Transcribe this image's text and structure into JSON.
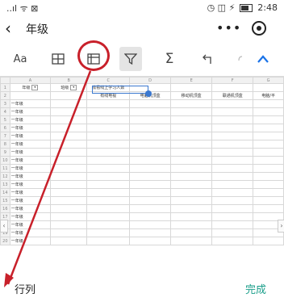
{
  "status_bar": {
    "signal": "..ıl ᯤ ⊠",
    "time": "2:48",
    "indicators": "◷ ◫ ⚡"
  },
  "title_bar": {
    "back_icon": "chevron-left-icon",
    "title": "年级",
    "more": "•••",
    "target_icon": "target-icon"
  },
  "toolbar": {
    "font": "Aa",
    "sigma": "Σ"
  },
  "sheet": {
    "col_letters": [
      "",
      "A",
      "B",
      "C",
      "D",
      "E",
      "F",
      "G"
    ],
    "headers": [
      "年级",
      "班级",
      "有线电视",
      "电脑机顶盒",
      "移动机顶盒",
      "联通机顶盒",
      "电脑/平"
    ],
    "selected_header": "收看线上学习人数",
    "row_value": "一年级",
    "row_count": 18
  },
  "bottom_bar": {
    "label": "行列",
    "done": "完成"
  },
  "colors": {
    "annotation_red": "#c8202a",
    "accent_blue": "#1a73e8",
    "done_teal": "#1a9e8a"
  }
}
